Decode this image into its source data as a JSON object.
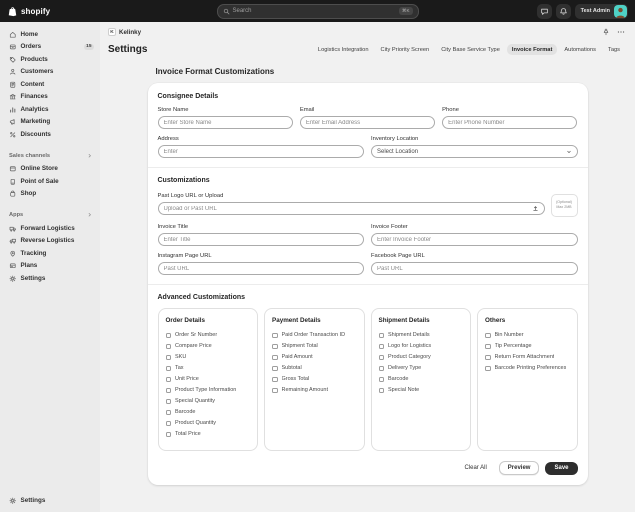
{
  "colors": {
    "topbar": "#1a1a1a",
    "sidebar_bg": "#ebebeb",
    "main_bg": "#f1f1f1",
    "card_bg": "#ffffff",
    "save_btn": "#2e2e2e",
    "active_tab_bg": "#e2e2e2",
    "avatar_bg": "#4fd1c5"
  },
  "topbar": {
    "logo_text": "shopify",
    "search": {
      "placeholder": "Search",
      "shortcut": "⌘K"
    },
    "user": {
      "name": "Test Admin"
    }
  },
  "sidebar": {
    "main_items": [
      {
        "label": "Home",
        "icon": "home-icon"
      },
      {
        "label": "Orders",
        "icon": "orders-icon",
        "badge": "15"
      },
      {
        "label": "Products",
        "icon": "products-icon"
      },
      {
        "label": "Customers",
        "icon": "customers-icon"
      },
      {
        "label": "Content",
        "icon": "content-icon"
      },
      {
        "label": "Finances",
        "icon": "finances-icon"
      },
      {
        "label": "Analytics",
        "icon": "analytics-icon"
      },
      {
        "label": "Marketing",
        "icon": "marketing-icon"
      },
      {
        "label": "Discounts",
        "icon": "discounts-icon"
      }
    ],
    "sections": [
      {
        "title": "Sales channels",
        "items": [
          {
            "label": "Online Store",
            "icon": "online-store-icon"
          },
          {
            "label": "Point of Sale",
            "icon": "pos-icon"
          },
          {
            "label": "Shop",
            "icon": "shop-icon"
          }
        ]
      },
      {
        "title": "Apps",
        "items": [
          {
            "label": "Forward Logistics",
            "icon": "forward-logistics-icon"
          },
          {
            "label": "Reverse Logistics",
            "icon": "reverse-logistics-icon"
          },
          {
            "label": "Tracking",
            "icon": "tracking-icon"
          },
          {
            "label": "Plans",
            "icon": "plans-icon"
          },
          {
            "label": "Settings",
            "icon": "app-settings-icon"
          }
        ]
      }
    ],
    "footer_item": {
      "label": "Settings",
      "icon": "settings-icon"
    }
  },
  "header": {
    "app_name": "Kelinky",
    "page_title": "Settings",
    "tabs": [
      {
        "label": "Logistics Integration"
      },
      {
        "label": "City Priority Screen"
      },
      {
        "label": "City Base Service Type"
      },
      {
        "label": "Invoice Format",
        "active": true
      },
      {
        "label": "Automations"
      },
      {
        "label": "Tags"
      }
    ]
  },
  "content": {
    "title": "Invoice Format Customizations",
    "consignee": {
      "title": "Consignee Details",
      "fields": [
        {
          "label": "Store Name",
          "placeholder": "Enter Store Name"
        },
        {
          "label": "Email",
          "placeholder": "Enter Email Address"
        },
        {
          "label": "Phone",
          "placeholder": "Enter Phone Number"
        },
        {
          "label": "Address",
          "placeholder": "Enter"
        },
        {
          "label": "Inventory Location",
          "value": "Select Location"
        }
      ]
    },
    "customizations": {
      "title": "Customizations",
      "logo": {
        "label": "Past Logo URL or Upload",
        "placeholder": "Upload or Past URL"
      },
      "upload_hint": [
        "(Optional)",
        "Max 2MB"
      ],
      "fields": [
        {
          "label": "Invoice Title",
          "placeholder": "Enter Title"
        },
        {
          "label": "Invoice Footer",
          "placeholder": "Enter Invoice Footer"
        },
        {
          "label": "Instagram Page URL",
          "placeholder": "Past URL"
        },
        {
          "label": "Facebook Page URL",
          "placeholder": "Past URL"
        }
      ]
    },
    "advanced": {
      "title": "Advanced Customizations",
      "groups": [
        {
          "title": "Order Details",
          "items": [
            "Order Sr Number",
            "Compare Price",
            "SKU",
            "Tax",
            "Unit Price",
            "Product Type Information",
            "Special Quantity",
            "Barcode",
            "Product Quantity",
            "Total Price"
          ]
        },
        {
          "title": "Payment Details",
          "items": [
            "Paid Order Transaction ID",
            "Shipment Total",
            "Paid Amount",
            "Subtotal",
            "Gross Total",
            "Remaining Amount"
          ]
        },
        {
          "title": "Shipment Details",
          "items": [
            "Shipment Details",
            "Logo for Logistics",
            "Product Category",
            "Delivery Type",
            "Barcode",
            "Special Note"
          ]
        },
        {
          "title": "Others",
          "items": [
            "Bin Number",
            "Tip Percentage",
            "Return Form Attachment",
            "Barcode Printing Preferences"
          ]
        }
      ]
    },
    "actions": {
      "clear_all": "Clear All",
      "preview": "Preview",
      "save": "Save"
    }
  }
}
